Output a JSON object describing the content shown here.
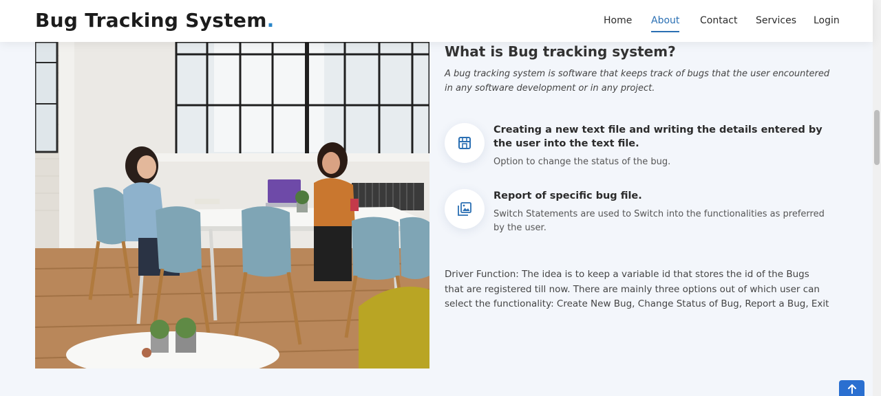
{
  "header": {
    "logo_text": "Bug Tracking System",
    "logo_dot": ".",
    "nav": [
      {
        "label": "Home",
        "active": false
      },
      {
        "label": "About",
        "active": true
      },
      {
        "label": "Contact",
        "active": false
      },
      {
        "label": "Services",
        "active": false
      },
      {
        "label": "Login",
        "active": false
      }
    ]
  },
  "about": {
    "title": "What is Bug tracking system?",
    "subtitle": "A bug tracking system is software that keeps track of bugs that the user encountered in any software development or in any project.",
    "features": [
      {
        "icon": "store-icon",
        "title": "Creating a new text file and writing the details entered by the user into the text file.",
        "desc": "Option to change the status of the bug."
      },
      {
        "icon": "images-icon",
        "title": "Report of specific bug file.",
        "desc": "Switch Statements are used to Switch into the functionalities as preferred by the user."
      }
    ],
    "driver_text": "Driver Function: The idea is to keep a variable id that stores the id of the Bugs that are registered till now. There are mainly three options out of which user can select the functionality: Create New Bug, Change Status of Bug, Report a Bug, Exit"
  },
  "image": {
    "subject": "office-photo"
  },
  "colors": {
    "accent": "#2a6fb3",
    "logo_dot": "#2a86c9",
    "page_bg": "#f3f6fb",
    "back_to_top": "#2a6fd0"
  },
  "back_to_top": {
    "icon": "arrow-up-icon"
  }
}
